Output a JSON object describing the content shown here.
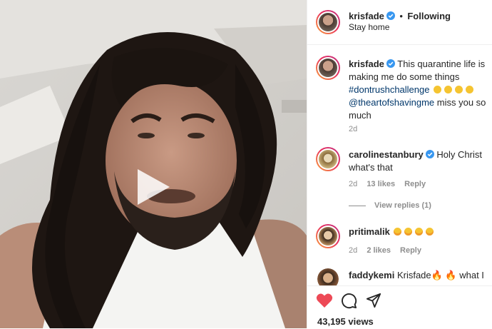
{
  "post": {
    "username": "krisfade",
    "separator": "•",
    "follow_status": "Following",
    "location": "Stay home",
    "caption_parts": [
      "This quarantine life is making me do some things ",
      "#dontrushchallenge",
      "@theartofshavingme",
      " miss you so much"
    ],
    "caption_age": "2d"
  },
  "comments": [
    {
      "username": "carolinestanbury",
      "text": "Holy Christ what's that",
      "age": "2d",
      "likes": "13 likes",
      "reply": "Reply",
      "view_replies": "View replies (1)"
    },
    {
      "username": "pritimalik",
      "age": "2d",
      "likes": "2 likes",
      "reply": "Reply"
    },
    {
      "username": "faddykemi",
      "text": "Krisfade🔥 🔥 what I"
    }
  ],
  "footer": {
    "views": "43,195 views"
  },
  "icons": [
    "play-icon",
    "verified-badge-icon",
    "heart-icon",
    "comment-icon",
    "share-icon"
  ],
  "colors": {
    "verified": "#3897f0",
    "heart": "#ed4956",
    "link": "#00376b",
    "muted": "#8e8e8e"
  }
}
